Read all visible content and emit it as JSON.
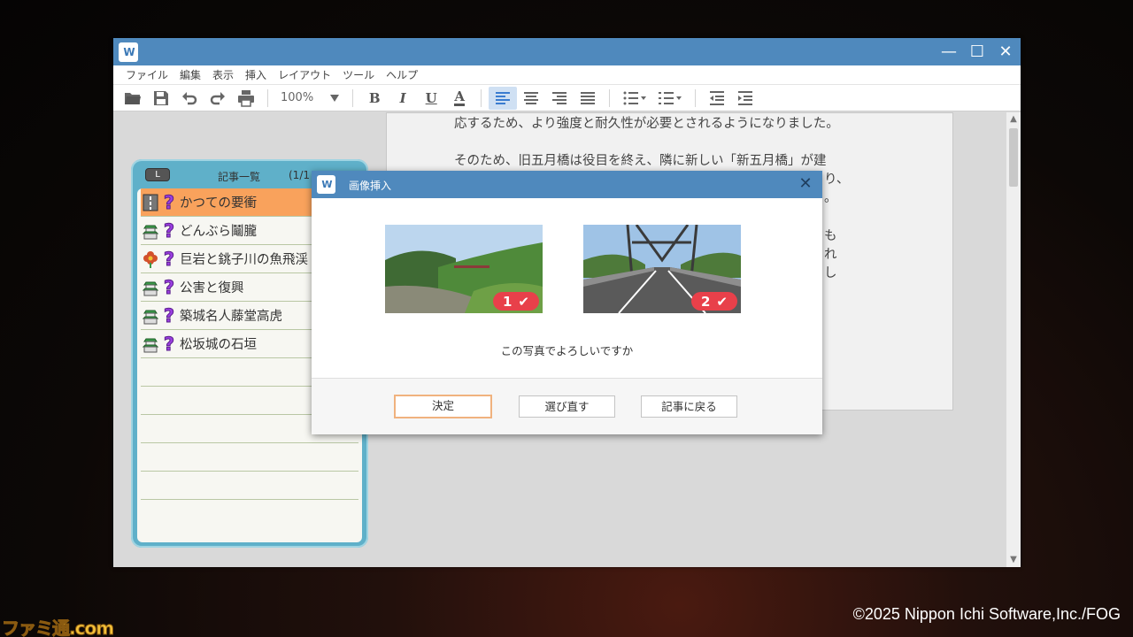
{
  "window": {
    "title_icon": "app-logo-icon",
    "logo_text": "W",
    "controls": {
      "minimize": "—",
      "maximize": "☐",
      "close": "✕"
    }
  },
  "menu": [
    "ファイル",
    "編集",
    "表示",
    "挿入",
    "レイアウト",
    "ツール",
    "ヘルプ"
  ],
  "toolbar": {
    "zoom": "100%",
    "bold": "B",
    "italic": "I",
    "underline": "U",
    "font_color": "A"
  },
  "document": {
    "lines": [
      "応するため、より強度と耐久性が必要とされるようになりました。",
      "そのため、旧五月橋は役目を終え、隣に新しい「新五月橋」が建"
    ],
    "fragments": [
      "り、",
      "。",
      "も",
      "れ",
      "し"
    ]
  },
  "article_panel": {
    "l_button": "L",
    "title": "記事一覧",
    "page": "(1/1",
    "items": [
      {
        "title": "かつての要衝",
        "icon": "road-icon",
        "selected": true
      },
      {
        "title": "どんぶら鬮朧",
        "icon": "castle-icon",
        "selected": false
      },
      {
        "title": "巨岩と銚子川の魚飛渓",
        "icon": "flower-icon",
        "selected": false
      },
      {
        "title": "公害と復興",
        "icon": "castle-icon",
        "selected": false
      },
      {
        "title": "築城名人藤堂高虎",
        "icon": "castle-icon",
        "selected": false
      },
      {
        "title": "松坂城の石垣",
        "icon": "castle-icon",
        "selected": false
      }
    ],
    "unknown_mark": "?"
  },
  "dialog": {
    "title": "画像挿入",
    "logo_text": "W",
    "close": "✕",
    "photos": [
      {
        "number": "1",
        "check": "✔",
        "subject": "river-valley-photo"
      },
      {
        "number": "2",
        "check": "✔",
        "subject": "bridge-road-photo"
      }
    ],
    "question": "この写真でよろしいですか",
    "buttons": {
      "confirm": "決定",
      "reselect": "選び直す",
      "back": "記事に戻る"
    }
  },
  "overlay": {
    "copyright": "©2025 Nippon Ichi Software,Inc./FOG",
    "watermark": "ファミ通.com"
  },
  "colors": {
    "titlebar": "#4f89bd",
    "panel": "#5fb0c9",
    "selected_row": "#f9a25c",
    "badge": "#e8404a",
    "focus_border": "#f0b27e"
  }
}
